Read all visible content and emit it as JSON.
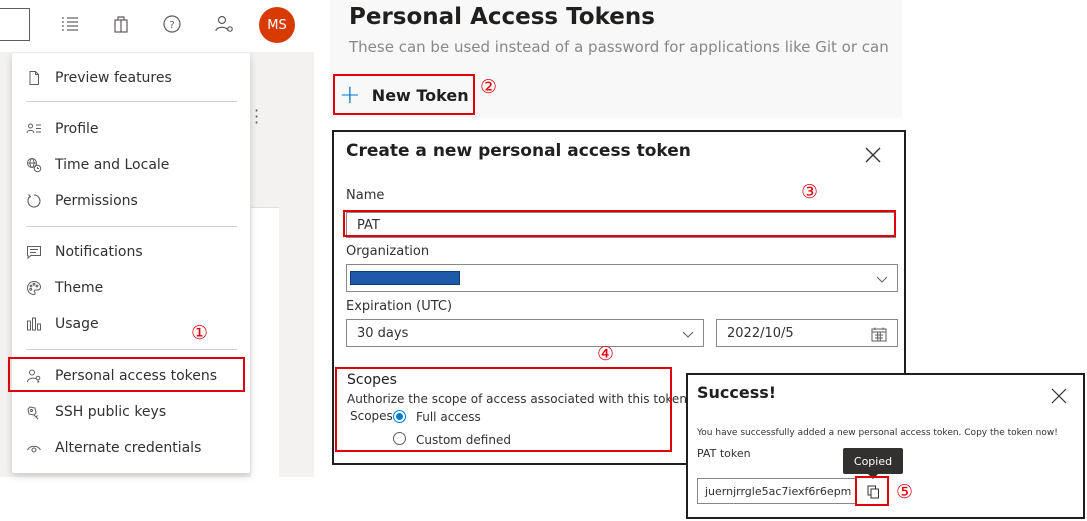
{
  "user": {
    "initials": "MS"
  },
  "menu": {
    "items": [
      {
        "label": "Preview features",
        "icon": "document-icon"
      },
      {
        "label": "Profile",
        "icon": "profile-icon"
      },
      {
        "label": "Time and Locale",
        "icon": "globe-clock-icon"
      },
      {
        "label": "Permissions",
        "icon": "refresh-icon"
      },
      {
        "label": "Notifications",
        "icon": "message-icon"
      },
      {
        "label": "Theme",
        "icon": "palette-icon"
      },
      {
        "label": "Usage",
        "icon": "chart-icon"
      },
      {
        "label": "Personal access tokens",
        "icon": "people-key-icon"
      },
      {
        "label": "SSH public keys",
        "icon": "key-icon"
      },
      {
        "label": "Alternate credentials",
        "icon": "eye-icon"
      }
    ]
  },
  "pat_page": {
    "title": "Personal Access Tokens",
    "subtitle": "These can be used instead of a password for applications like Git or can",
    "new_token_label": "New Token"
  },
  "create_dialog": {
    "title": "Create a new personal access token",
    "name_label": "Name",
    "name_value": "PAT",
    "org_label": "Organization",
    "expiration_label": "Expiration (UTC)",
    "expiration_value": "30 days",
    "date_value": "2022/10/5",
    "scopes_title": "Scopes",
    "scopes_desc": "Authorize the scope of access associated with this token",
    "scopes_inline": "Scopes",
    "full_access": "Full access",
    "custom_defined": "Custom defined",
    "selected_scope": "Full access"
  },
  "success_dialog": {
    "title": "Success!",
    "message": "You have successfully added a new personal access token. Copy the token now!",
    "token_label": "PAT token",
    "token_value": "juernjrrgle5ac7iexf6r6epm",
    "tooltip": "Copied"
  },
  "annotations": {
    "step1": "①",
    "step2": "②",
    "step3": "③",
    "step4": "④",
    "step5": "⑤",
    "color": "#e0000a"
  },
  "colors": {
    "accent": "#0078d4",
    "avatar": "#d83b01",
    "highlight": "#e0000a"
  }
}
